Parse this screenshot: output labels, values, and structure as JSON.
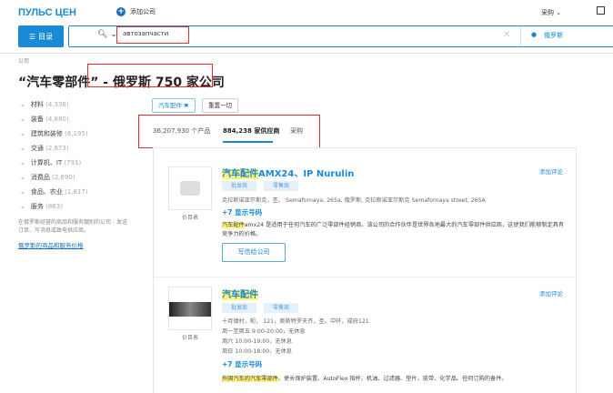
{
  "header": {
    "logo": "ПУЛЬС ЦЕН",
    "add_company": "添加公司",
    "purchase": "采购",
    "catalog_button": "目录"
  },
  "search": {
    "value": "автозапчасти",
    "location": "俄罗斯"
  },
  "breadcrumb": "公司",
  "page_title": {
    "query": "“汽车零部件”",
    "rest": " - 俄罗斯 750 家公司"
  },
  "sidebar": {
    "items": [
      {
        "label": "材料",
        "count": "(4,338)"
      },
      {
        "label": "装备",
        "count": "(4,880)"
      },
      {
        "label": "建筑和装修",
        "count": "(6,195)"
      },
      {
        "label": "交通",
        "count": "(2,873)"
      },
      {
        "label": "计算机、IT",
        "count": "(791)"
      },
      {
        "label": "消费品",
        "count": "(2,690)"
      },
      {
        "label": "食品、农业",
        "count": "(1,817)"
      },
      {
        "label": "服务",
        "count": "(863)"
      }
    ],
    "note": "在俄罗斯经营的商品和服务類别的公司 - 发送订单、写消息或致电供应商。",
    "link": "俄罗斯的商品和服务价格"
  },
  "filters": {
    "active_chip": "汽车配件",
    "reset": "重置一切"
  },
  "tabs": [
    {
      "label": "36,207,930 个产品"
    },
    {
      "label": "884,238 家供应商",
      "active": true
    },
    {
      "label": "采购"
    }
  ],
  "results": [
    {
      "title_hl": "汽车配件",
      "title_rest": "AMX24、IP Nurulin",
      "badges": [
        "批发商",
        "零售商"
      ],
      "lines": [
        "克拉斯诺亚尔斯克，圣。 Semafornaya, 265a, 俄罗斯, 克拉斯诺亚尔斯克 Semafornaya street, 265A"
      ],
      "phone": "+7 显示号码",
      "desc_hl": "汽车配件",
      "desc": "amx24 是适用于任何汽车的广泛零部件经销商。该公司的合作伙伴是世界各地最大的汽车零部件供应商，这使我们能够制定具有竞争力的价格。",
      "price_list": "价目表",
      "review": "添加评论",
      "write_button": "写信给公司"
    },
    {
      "title_hl": "汽车配件",
      "title_rest": "",
      "badges": [
        "批发商",
        "零售商"
      ],
      "lines": [
        "十月镇村，呃， 121，奥斯特罗夫齐，圣。中环，成府121",
        "周一至周五 9:00-20:00，无休息",
        "周六 10:00-19:00，无休息",
        "周日 10:00-18:00，无休息"
      ],
      "phone": "+7 显示号码",
      "desc_hl": "外国汽车的汽车零部件",
      "desc": "、使长保护装置、AutoFlex 指杆、机油、过滤器、垫片、皮带、化学品、任何订购的备件。",
      "price_list": "价目表",
      "review": "添加评论"
    }
  ],
  "colors": {
    "accent": "#1a8ad4",
    "highlight": "#fff27a",
    "annotation": "#e03030"
  }
}
